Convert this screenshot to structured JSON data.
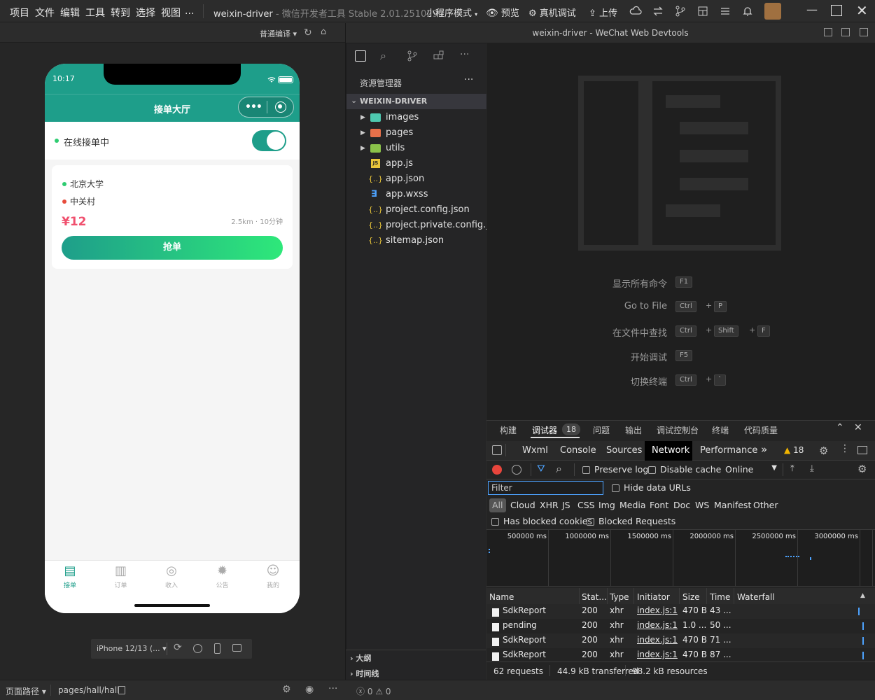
{
  "menu": [
    "项目",
    "文件",
    "编辑",
    "工具",
    "转到",
    "选择",
    "视图",
    "..."
  ],
  "title": {
    "project": "weixin-driver",
    "separator": " - ",
    "app": "微信开发者工具 Stable 2.01.2510290"
  },
  "toolbar": {
    "mode": "小程序模式",
    "preview": "预览",
    "remote_debug": "真机调试",
    "upload": "上传"
  },
  "sim_toolbar": {
    "compile": "普通编译"
  },
  "phone": {
    "time": "10:17",
    "nav_title": "接单大厅",
    "online_label": "在线接单中",
    "order": {
      "from": "北京大学",
      "to": "中关村",
      "price": "¥12",
      "meta": "2.5km · 10分钟",
      "grab_button": "抢单"
    },
    "tabbar": [
      {
        "label": "接单",
        "icon": "order-icon"
      },
      {
        "label": "订单",
        "icon": "list-icon"
      },
      {
        "label": "收入",
        "icon": "income-icon"
      },
      {
        "label": "公告",
        "icon": "notice-icon"
      },
      {
        "label": "我的",
        "icon": "user-icon"
      }
    ],
    "device": "iPhone 12/13 (..."
  },
  "explorer": {
    "title": "资源管理器",
    "root": "WEIXIN-DRIVER",
    "items": [
      {
        "name": "images",
        "type": "folder",
        "icon_color": "#4ec9b0"
      },
      {
        "name": "pages",
        "type": "folder",
        "icon_color": "#e8704a"
      },
      {
        "name": "utils",
        "type": "folder",
        "icon_color": "#8bc34a"
      },
      {
        "name": "app.js",
        "type": "js"
      },
      {
        "name": "app.json",
        "type": "json"
      },
      {
        "name": "app.wxss",
        "type": "css"
      },
      {
        "name": "project.config.json",
        "type": "json"
      },
      {
        "name": "project.private.config.js...",
        "type": "json"
      },
      {
        "name": "sitemap.json",
        "type": "json"
      }
    ],
    "outline": "大纲",
    "timeline": "时间线"
  },
  "editor": {
    "window_title": "weixin-driver - WeChat Web Devtools",
    "commands": [
      {
        "label": "显示所有命令",
        "keys": [
          "F1"
        ]
      },
      {
        "label": "Go to File",
        "keys": [
          "Ctrl",
          "P"
        ]
      },
      {
        "label": "在文件中查找",
        "keys": [
          "Ctrl",
          "Shift",
          "F"
        ]
      },
      {
        "label": "开始调试",
        "keys": [
          "F5"
        ]
      },
      {
        "label": "切换终端",
        "keys": [
          "Ctrl",
          "`"
        ]
      }
    ]
  },
  "devtools": {
    "top_tabs": [
      "构建",
      "调试器",
      "问题",
      "输出",
      "调试控制台",
      "终端",
      "代码质量"
    ],
    "debugger_badge": "18",
    "panel_tabs": [
      "Wxml",
      "Console",
      "Sources",
      "Network",
      "Performance"
    ],
    "more": "»",
    "warning_count": "18",
    "preserve_log": "Preserve log",
    "disable_cache": "Disable cache",
    "throttle": "Online",
    "filter_placeholder": "Filter",
    "hide_data_urls": "Hide data URLs",
    "type_filters": [
      "All",
      "Cloud",
      "XHR",
      "JS",
      "CSS",
      "Img",
      "Media",
      "Font",
      "Doc",
      "WS",
      "Manifest",
      "Other"
    ],
    "has_blocked_cookies": "Has blocked cookies",
    "blocked_requests": "Blocked Requests",
    "timeline_ticks": [
      "500000 ms",
      "1000000 ms",
      "1500000 ms",
      "2000000 ms",
      "2500000 ms",
      "3000000 ms"
    ],
    "columns": [
      "Name",
      "Stat...",
      "Type",
      "Initiator",
      "Size",
      "Time",
      "Waterfall"
    ],
    "rows": [
      {
        "name": "SdkReport",
        "status": "200",
        "type": "xhr",
        "initiator": "index.js:1",
        "size": "470 B",
        "time": "43 ..."
      },
      {
        "name": "pending",
        "status": "200",
        "type": "xhr",
        "initiator": "index.js:1",
        "size": "1.0 ...",
        "time": "50 ..."
      },
      {
        "name": "SdkReport",
        "status": "200",
        "type": "xhr",
        "initiator": "index.js:1",
        "size": "470 B",
        "time": "71 ..."
      },
      {
        "name": "SdkReport",
        "status": "200",
        "type": "xhr",
        "initiator": "index.js:1",
        "size": "470 B",
        "time": "87 ..."
      }
    ],
    "summary": {
      "requests": "62 requests",
      "transferred": "44.9 kB transferred",
      "resources": "98.2 kB resources"
    }
  },
  "statusbar": {
    "page_path_label": "页面路径",
    "page_path": "pages/hall/hall",
    "errors": "0",
    "warnings": "0"
  },
  "colors": {
    "brand": "#1e9e8a",
    "accent": "#2ecc71",
    "price": "#f0506e",
    "network_active": "#000000"
  }
}
